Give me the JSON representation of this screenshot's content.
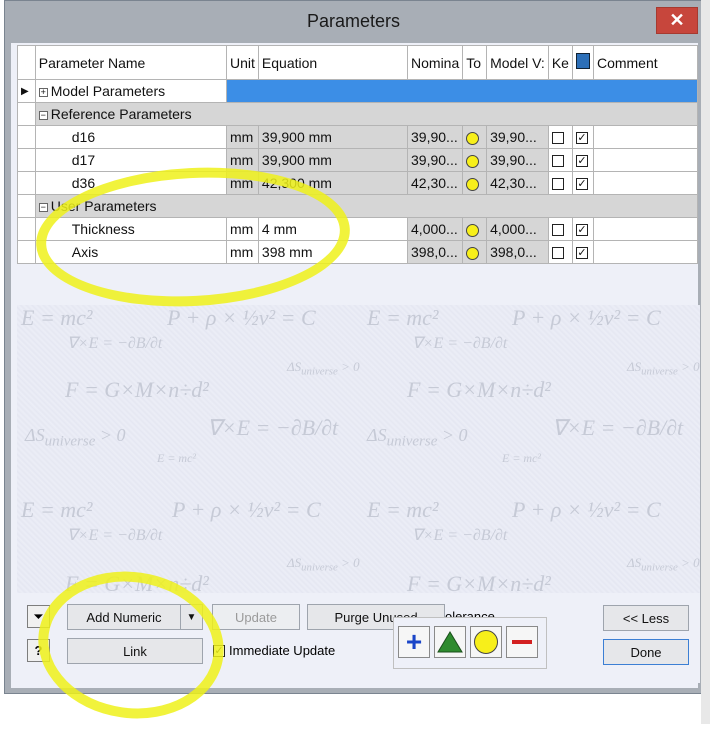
{
  "window": {
    "title": "Parameters",
    "close_label": "✕"
  },
  "columns": [
    "Parameter Name",
    "Unit",
    "Equation",
    "Nomina",
    "To",
    "Model V:",
    "Ke",
    "",
    "Comment"
  ],
  "groups": {
    "model": "Model Parameters",
    "reference": "Reference Parameters",
    "user": "User Parameters"
  },
  "reference_rows": [
    {
      "name": "d16",
      "unit": "mm",
      "equation": "39,900 mm",
      "nominal": "39,90...",
      "model": "39,90..."
    },
    {
      "name": "d17",
      "unit": "mm",
      "equation": "39,900 mm",
      "nominal": "39,90...",
      "model": "39,90..."
    },
    {
      "name": "d36",
      "unit": "mm",
      "equation": "42,300 mm",
      "nominal": "42,30...",
      "model": "42,30..."
    }
  ],
  "user_rows": [
    {
      "name": "Thickness",
      "unit": "mm",
      "equation": "4 mm",
      "nominal": "4,000...",
      "model": "4,000..."
    },
    {
      "name": "Axis",
      "unit": "mm",
      "equation": "398 mm",
      "nominal": "398,0...",
      "model": "398,0..."
    }
  ],
  "buttons": {
    "add_numeric": "Add Numeric",
    "update": "Update",
    "purge_unused": "Purge Unused",
    "link": "Link",
    "immediate_update": "Immediate Update",
    "less": "<< Less",
    "done": "Done",
    "tolerance": "olerance"
  },
  "colors": {
    "selection": "#3c8ee6",
    "tolerance_circle": "#f7ef1a",
    "annotation": "#eef11a"
  }
}
